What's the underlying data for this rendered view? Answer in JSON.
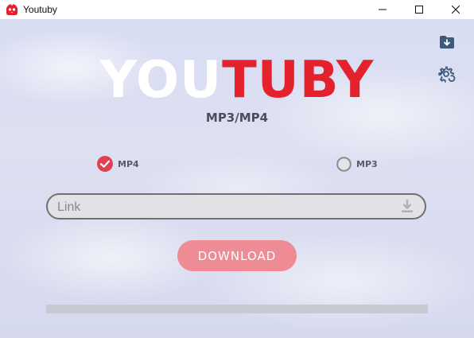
{
  "window": {
    "title": "Youtuby",
    "controls": {
      "minimize": "minimize-icon",
      "maximize": "maximize-icon",
      "close": "close-icon"
    }
  },
  "logo": {
    "part1": "YOU",
    "part2": "TUBY",
    "subtitle": "MP3/MP4"
  },
  "toolbar": {
    "folder_icon": "folder-download-icon",
    "settings_icon": "gear-refresh-icon"
  },
  "format_options": [
    {
      "label": "MP4",
      "selected": true
    },
    {
      "label": "MP3",
      "selected": false
    }
  ],
  "link": {
    "placeholder": "Link",
    "value": ""
  },
  "download_button": {
    "label": "DOWNLOAD"
  },
  "progress": {
    "fraction": 0
  },
  "colors": {
    "accent_red": "#e3222e",
    "button_pink": "#ee8b95",
    "radio_red": "#e0404f"
  }
}
